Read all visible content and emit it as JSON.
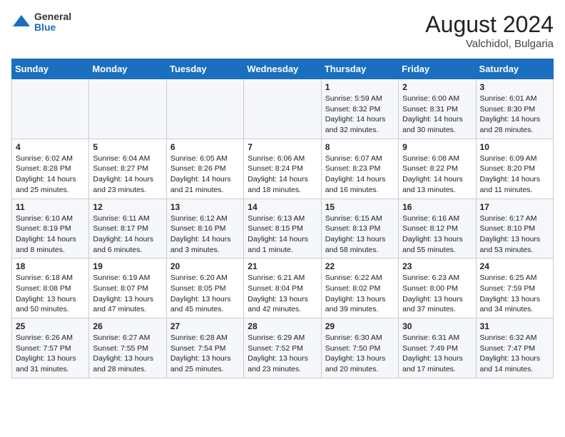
{
  "header": {
    "logo_general": "General",
    "logo_blue": "Blue",
    "month_year": "August 2024",
    "location": "Valchidol, Bulgaria"
  },
  "days_of_week": [
    "Sunday",
    "Monday",
    "Tuesday",
    "Wednesday",
    "Thursday",
    "Friday",
    "Saturday"
  ],
  "weeks": [
    [
      {
        "day": "",
        "content": ""
      },
      {
        "day": "",
        "content": ""
      },
      {
        "day": "",
        "content": ""
      },
      {
        "day": "",
        "content": ""
      },
      {
        "day": "1",
        "content": "Sunrise: 5:59 AM\nSunset: 8:32 PM\nDaylight: 14 hours and 32 minutes."
      },
      {
        "day": "2",
        "content": "Sunrise: 6:00 AM\nSunset: 8:31 PM\nDaylight: 14 hours and 30 minutes."
      },
      {
        "day": "3",
        "content": "Sunrise: 6:01 AM\nSunset: 8:30 PM\nDaylight: 14 hours and 28 minutes."
      }
    ],
    [
      {
        "day": "4",
        "content": "Sunrise: 6:02 AM\nSunset: 8:28 PM\nDaylight: 14 hours and 25 minutes."
      },
      {
        "day": "5",
        "content": "Sunrise: 6:04 AM\nSunset: 8:27 PM\nDaylight: 14 hours and 23 minutes."
      },
      {
        "day": "6",
        "content": "Sunrise: 6:05 AM\nSunset: 8:26 PM\nDaylight: 14 hours and 21 minutes."
      },
      {
        "day": "7",
        "content": "Sunrise: 6:06 AM\nSunset: 8:24 PM\nDaylight: 14 hours and 18 minutes."
      },
      {
        "day": "8",
        "content": "Sunrise: 6:07 AM\nSunset: 8:23 PM\nDaylight: 14 hours and 16 minutes."
      },
      {
        "day": "9",
        "content": "Sunrise: 6:08 AM\nSunset: 8:22 PM\nDaylight: 14 hours and 13 minutes."
      },
      {
        "day": "10",
        "content": "Sunrise: 6:09 AM\nSunset: 8:20 PM\nDaylight: 14 hours and 11 minutes."
      }
    ],
    [
      {
        "day": "11",
        "content": "Sunrise: 6:10 AM\nSunset: 8:19 PM\nDaylight: 14 hours and 8 minutes."
      },
      {
        "day": "12",
        "content": "Sunrise: 6:11 AM\nSunset: 8:17 PM\nDaylight: 14 hours and 6 minutes."
      },
      {
        "day": "13",
        "content": "Sunrise: 6:12 AM\nSunset: 8:16 PM\nDaylight: 14 hours and 3 minutes."
      },
      {
        "day": "14",
        "content": "Sunrise: 6:13 AM\nSunset: 8:15 PM\nDaylight: 14 hours and 1 minute."
      },
      {
        "day": "15",
        "content": "Sunrise: 6:15 AM\nSunset: 8:13 PM\nDaylight: 13 hours and 58 minutes."
      },
      {
        "day": "16",
        "content": "Sunrise: 6:16 AM\nSunset: 8:12 PM\nDaylight: 13 hours and 55 minutes."
      },
      {
        "day": "17",
        "content": "Sunrise: 6:17 AM\nSunset: 8:10 PM\nDaylight: 13 hours and 53 minutes."
      }
    ],
    [
      {
        "day": "18",
        "content": "Sunrise: 6:18 AM\nSunset: 8:08 PM\nDaylight: 13 hours and 50 minutes."
      },
      {
        "day": "19",
        "content": "Sunrise: 6:19 AM\nSunset: 8:07 PM\nDaylight: 13 hours and 47 minutes."
      },
      {
        "day": "20",
        "content": "Sunrise: 6:20 AM\nSunset: 8:05 PM\nDaylight: 13 hours and 45 minutes."
      },
      {
        "day": "21",
        "content": "Sunrise: 6:21 AM\nSunset: 8:04 PM\nDaylight: 13 hours and 42 minutes."
      },
      {
        "day": "22",
        "content": "Sunrise: 6:22 AM\nSunset: 8:02 PM\nDaylight: 13 hours and 39 minutes."
      },
      {
        "day": "23",
        "content": "Sunrise: 6:23 AM\nSunset: 8:00 PM\nDaylight: 13 hours and 37 minutes."
      },
      {
        "day": "24",
        "content": "Sunrise: 6:25 AM\nSunset: 7:59 PM\nDaylight: 13 hours and 34 minutes."
      }
    ],
    [
      {
        "day": "25",
        "content": "Sunrise: 6:26 AM\nSunset: 7:57 PM\nDaylight: 13 hours and 31 minutes."
      },
      {
        "day": "26",
        "content": "Sunrise: 6:27 AM\nSunset: 7:55 PM\nDaylight: 13 hours and 28 minutes."
      },
      {
        "day": "27",
        "content": "Sunrise: 6:28 AM\nSunset: 7:54 PM\nDaylight: 13 hours and 25 minutes."
      },
      {
        "day": "28",
        "content": "Sunrise: 6:29 AM\nSunset: 7:52 PM\nDaylight: 13 hours and 23 minutes."
      },
      {
        "day": "29",
        "content": "Sunrise: 6:30 AM\nSunset: 7:50 PM\nDaylight: 13 hours and 20 minutes."
      },
      {
        "day": "30",
        "content": "Sunrise: 6:31 AM\nSunset: 7:49 PM\nDaylight: 13 hours and 17 minutes."
      },
      {
        "day": "31",
        "content": "Sunrise: 6:32 AM\nSunset: 7:47 PM\nDaylight: 13 hours and 14 minutes."
      }
    ]
  ]
}
